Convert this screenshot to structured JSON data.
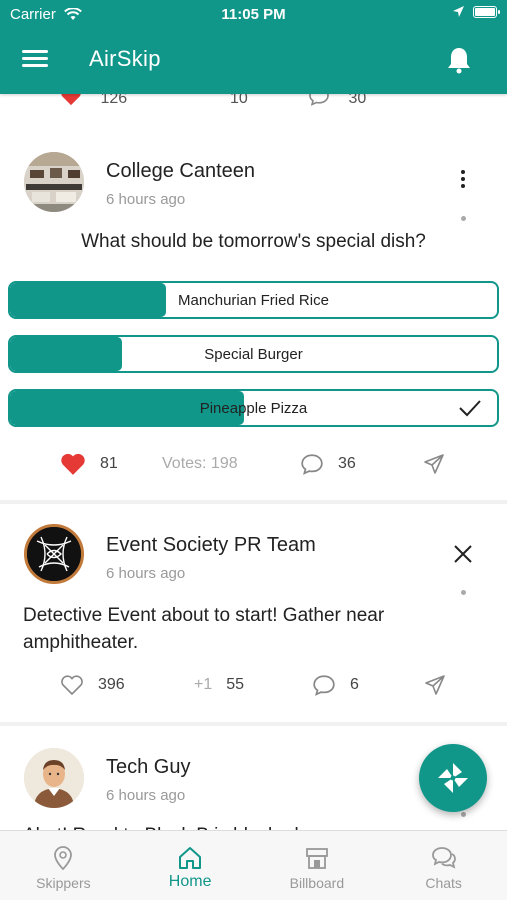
{
  "colors": {
    "accent": "#11978a",
    "like": "#e53935",
    "muted": "#999999"
  },
  "status": {
    "carrier": "Carrier",
    "time": "11:05 PM"
  },
  "header": {
    "title": "AirSkip",
    "menu_icon": "menu-icon",
    "bell_icon": "bell-icon"
  },
  "partial_post": {
    "likes": "126",
    "plus": "10",
    "comments": "30"
  },
  "post1": {
    "author": "College Canteen",
    "time": "6 hours ago",
    "question": "What should be tomorrow's special dish?",
    "options": [
      {
        "label": "Manchurian Fried Rice",
        "share": 0.32
      },
      {
        "label": "Special Burger",
        "share": 0.23
      },
      {
        "label": "Pineapple Pizza",
        "share": 0.48,
        "selected": true
      }
    ],
    "likes": "81",
    "votes_label": "Votes: 198",
    "comments": "36"
  },
  "post2": {
    "author": "Event Society PR Team",
    "time": "6 hours ago",
    "text": "Detective Event about to start! Gather near amphitheater.",
    "likes": "396",
    "plus_label": "+1",
    "plus_count": "55",
    "comments": "6"
  },
  "post3": {
    "author": "Tech Guy",
    "time": "6 hours ago",
    "text_partial": "Alert! Road to Block B is blocked"
  },
  "tabs": [
    {
      "label": "Skippers",
      "icon": "location-pin-icon"
    },
    {
      "label": "Home",
      "icon": "home-icon",
      "active": true
    },
    {
      "label": "Billboard",
      "icon": "billboard-icon"
    },
    {
      "label": "Chats",
      "icon": "chat-bubbles-icon"
    }
  ]
}
